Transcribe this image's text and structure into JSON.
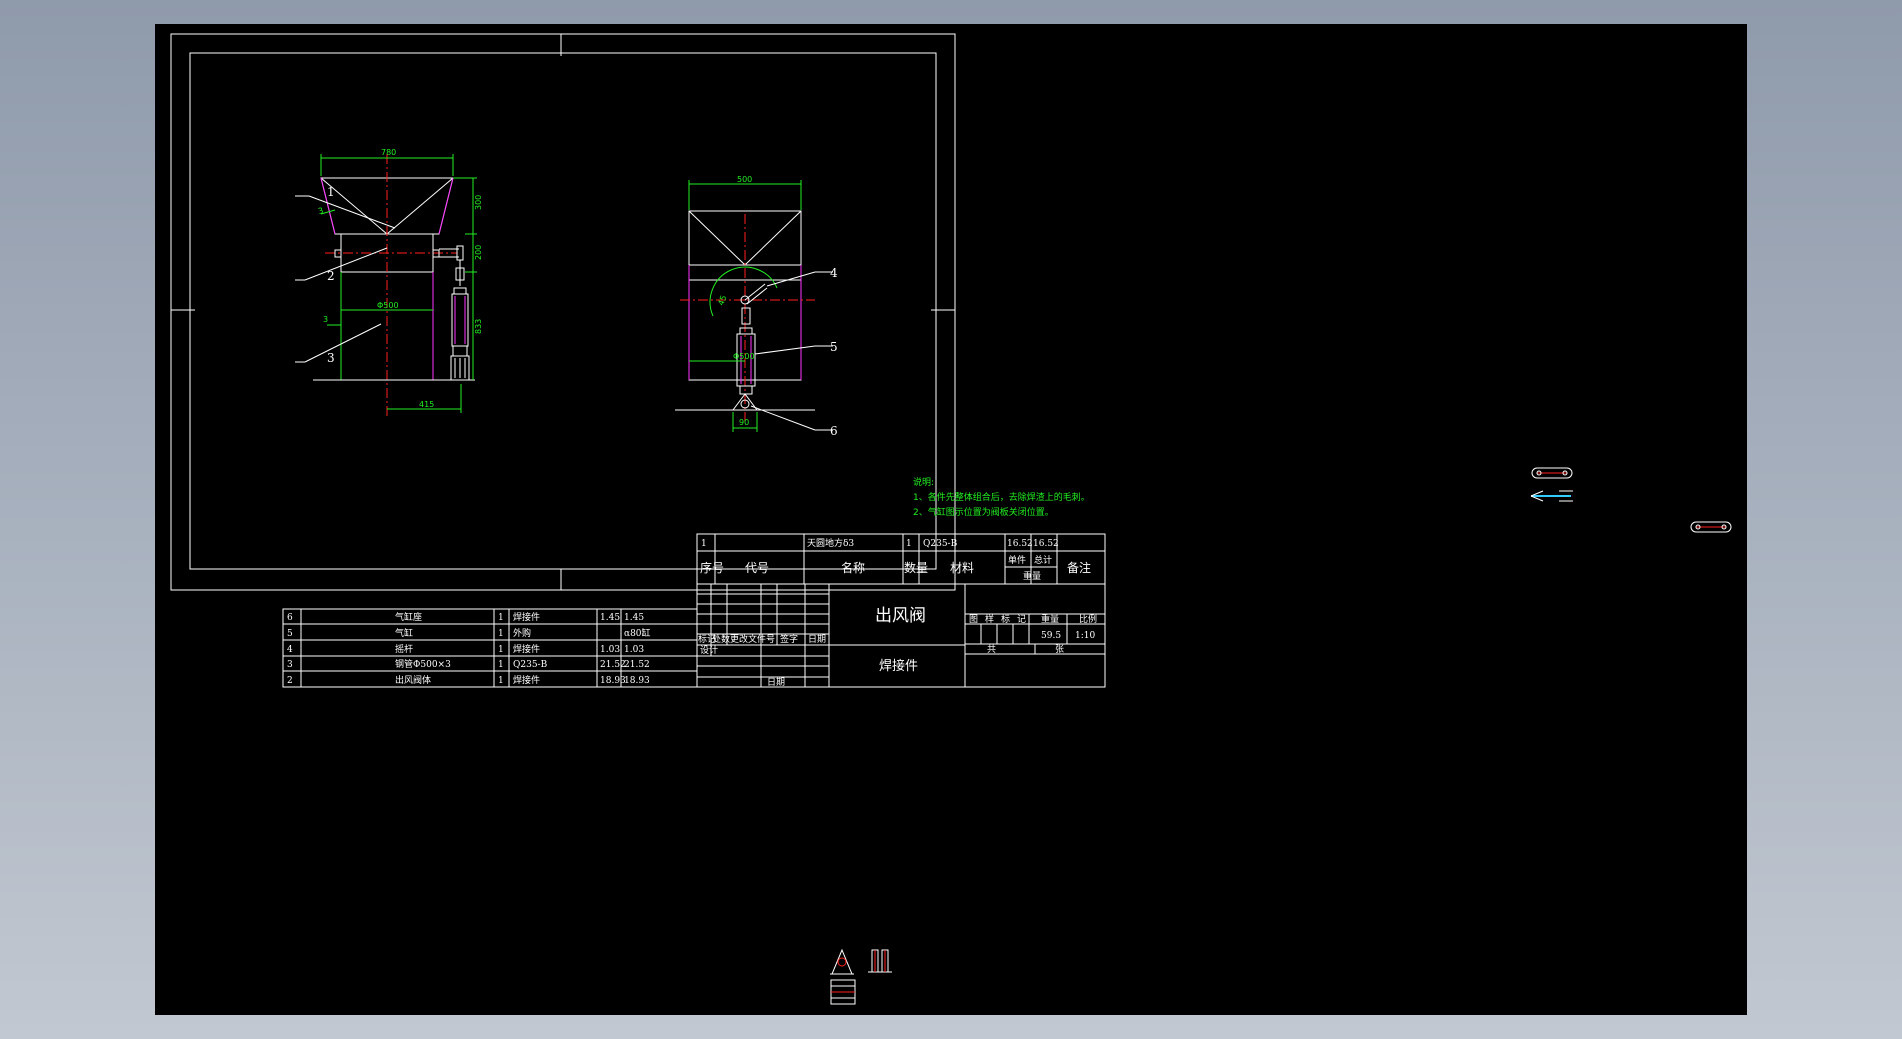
{
  "drawing": {
    "title": "出风阀",
    "subtitle": "焊接件",
    "scale_header": "比例",
    "scale": "1:10",
    "weight_header": "重量",
    "weight": "59.5",
    "stage_labels": [
      "图",
      "样",
      "标",
      "记"
    ],
    "sheet_total": "共",
    "sheet_index": "张",
    "design_label": "设计",
    "date_label": "日期",
    "revision_headers": [
      "标记",
      "处数",
      "更改文件号",
      "签字",
      "日期"
    ]
  },
  "notes": {
    "heading": "说明:",
    "lines": [
      "1、各件先整体组合后，去除焊渣上的毛刺。",
      "2、气缸图示位置为阀板关闭位置。"
    ]
  },
  "dimensions": {
    "front_width": "780",
    "front_h1": "300",
    "front_h2": "200",
    "front_h3": "833",
    "front_dia": "Φ500",
    "front_offset": "415",
    "side_width": "500",
    "side_dia": "Φ500",
    "side_angle": "45",
    "side_base": "90",
    "plate_thk": "3"
  },
  "callouts": [
    "1",
    "2",
    "3",
    "4",
    "5",
    "6"
  ],
  "bom": {
    "headers": [
      "序号",
      "代号",
      "名称",
      "数量",
      "材料",
      "单件",
      "总计",
      "重量",
      "备注"
    ],
    "rows": [
      {
        "no": "6",
        "name": "气缸座",
        "qty": "1",
        "mat": "焊接件",
        "unit": "1.45",
        "total": "1.45"
      },
      {
        "no": "5",
        "name": "气缸",
        "qty": "1",
        "mat": "外购",
        "unit": "",
        "total": "α80缸"
      },
      {
        "no": "4",
        "name": "摇杆",
        "qty": "1",
        "mat": "焊接件",
        "unit": "1.03",
        "total": "1.03"
      },
      {
        "no": "3",
        "name": "钢管Φ500×3",
        "qty": "1",
        "mat": "Q235-B",
        "unit": "21.52",
        "total": "21.52"
      },
      {
        "no": "2",
        "name": "出风阀体",
        "qty": "1",
        "mat": "焊接件",
        "unit": "18.93",
        "total": "18.93"
      },
      {
        "no": "1",
        "name": "天圆地方δ3",
        "qty": "1",
        "mat": "Q235-B",
        "unit": "16.52",
        "total": "16.52"
      }
    ]
  },
  "colors": {
    "background": "#000000",
    "linework": "#ffffff",
    "dimension": "#22ee22",
    "centerline": "#ff2020",
    "hidden": "#ff33ff",
    "highlight": "#33ccff",
    "frame_outer": "#8f9aab"
  }
}
